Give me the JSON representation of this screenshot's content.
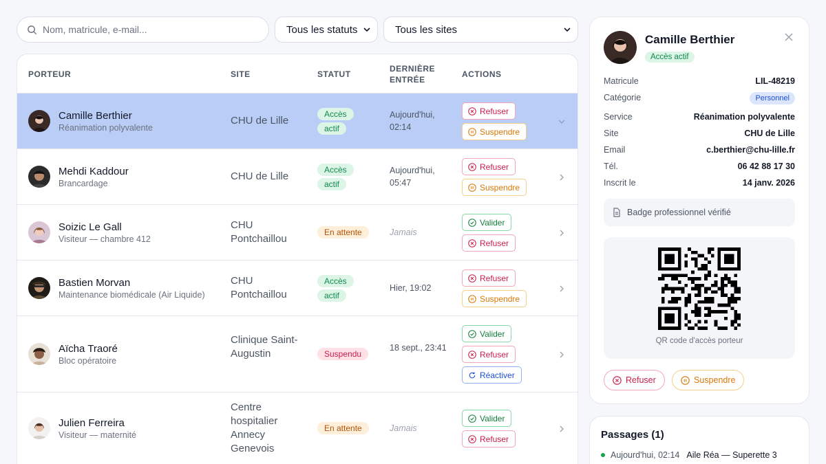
{
  "filters": {
    "search_placeholder": "Nom, matricule, e-mail...",
    "status_value": "Tous les statuts",
    "site_value": "Tous les sites"
  },
  "table": {
    "headers": {
      "porteur": "PORTEUR",
      "site": "SITE",
      "statut": "STATUT",
      "derniere_entree_1": "DERNIÈRE",
      "derniere_entree_2": "ENTRÉE",
      "actions": "ACTIONS"
    },
    "rows": [
      {
        "name": "Camille Berthier",
        "sub": "Réanimation polyvalente",
        "site": "CHU de Lille",
        "status": "Accès actif",
        "date": "Aujourd'hui, 02:14",
        "actions": [
          "Refuser",
          "Suspendre"
        ]
      },
      {
        "name": "Mehdi Kaddour",
        "sub": "Brancardage",
        "site": "CHU de Lille",
        "status": "Accès actif",
        "date": "Aujourd'hui, 05:47",
        "actions": [
          "Refuser",
          "Suspendre"
        ]
      },
      {
        "name": "Soizic Le Gall",
        "sub": "Visiteur — chambre 412",
        "site": "CHU Pontchaillou",
        "status": "En attente",
        "date": "Jamais",
        "actions": [
          "Valider",
          "Refuser"
        ]
      },
      {
        "name": "Bastien Morvan",
        "sub": "Maintenance biomédicale (Air Liquide)",
        "site": "CHU Pontchaillou",
        "status": "Accès actif",
        "date": "Hier, 19:02",
        "actions": [
          "Refuser",
          "Suspendre"
        ]
      },
      {
        "name": "Aïcha Traoré",
        "sub": "Bloc opératoire",
        "site": "Clinique Saint-Augustin",
        "status": "Suspendu",
        "date": "18 sept., 23:41",
        "actions": [
          "Valider",
          "Refuser",
          "Réactiver"
        ]
      },
      {
        "name": "Julien Ferreira",
        "sub": "Visiteur — maternité",
        "site": "Centre hospitalier Annecy Genevois",
        "status": "En attente",
        "date": "Jamais",
        "actions": [
          "Valider",
          "Refuser"
        ]
      }
    ]
  },
  "detail": {
    "name": "Camille Berthier",
    "badge": "Accès actif",
    "fields": {
      "matricule_label": "Matricule",
      "matricule": "LIL-48219",
      "categorie_label": "Catégorie",
      "categorie": "Personnel",
      "service_label": "Service",
      "service": "Réanimation polyvalente",
      "site_label": "Site",
      "site": "CHU de Lille",
      "email_label": "Email",
      "email": "c.berthier@chu-lille.fr",
      "tel_label": "Tél.",
      "tel": "06 42 88 17 30",
      "inscrit_label": "Inscrit le",
      "inscrit": "14 janv. 2026"
    },
    "verification": "Badge professionnel vérifié",
    "qr_caption": "QR code d'accès porteur",
    "refuse_label": "Refuser",
    "suspend_label": "Suspendre"
  },
  "passages": {
    "title": "Passages (1)",
    "items": [
      {
        "time": "Aujourd'hui, 02:14",
        "location": "Aile Réa — Superette 3"
      }
    ]
  },
  "colors": {
    "selected_row": "#b9cdf7",
    "green": "#0f8a4b",
    "red": "#c81e4a",
    "amber": "#d97706",
    "blue": "#1d4ed8"
  }
}
